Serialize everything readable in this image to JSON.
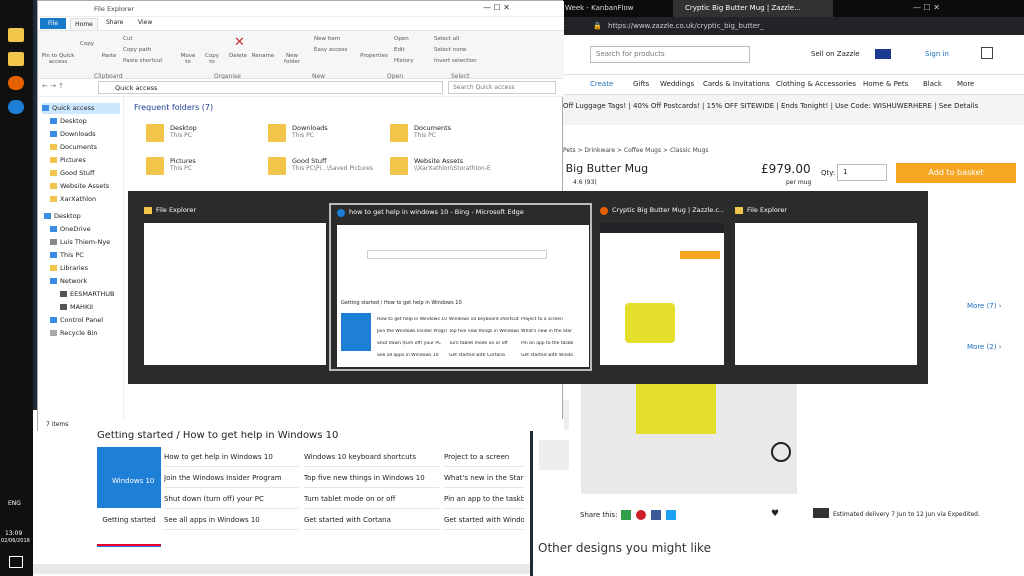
{
  "taskbar": {
    "clock_time": "13:09",
    "clock_date": "02/06/2018",
    "lang": "ENG",
    "items": [
      "explorer",
      "explorer",
      "firefox",
      "edge"
    ]
  },
  "firefox": {
    "tabs": [
      "Week - KanbanFlow",
      "Cryptic Big Butter Mug | Zazzle..."
    ],
    "url": "https://www.zazzle.co.uk/cryptic_big_butter_",
    "search_placeholder": "Search for products",
    "sell": "Sell on Zazzle",
    "signin": "Sign in",
    "nav": [
      "Create",
      "Gifts",
      "Weddings",
      "Cards & Invitations",
      "Clothing & Accessories",
      "Home & Pets",
      "Black",
      "More"
    ],
    "promo": "Off Luggage Tags! | 40% Off Postcards! | 15% OFF SITEWIDE | Ends Tonight! | Use Code: WISHUWERHERE | See Details",
    "crumbs": "Pets > Drinkware > Coffee Mugs > Classic Mugs",
    "product": "ic Big Butter Mug",
    "rating": "4.6 (93)",
    "price": "£979.00",
    "per": "per mug",
    "qty_label": "Qty:",
    "qty_value": "1",
    "add": "Add to basket",
    "more1": "More (7) ›",
    "more2": "More (2) ›",
    "share": "Share this:",
    "delivery": "Estimated delivery 7 Jun to 12 Jun via Expedited.",
    "other": "Other designs you might like"
  },
  "explorer": {
    "title": "File Explorer",
    "menu": [
      "File",
      "Home",
      "Share",
      "View"
    ],
    "clipboard": [
      "Pin to Quick access",
      "Copy",
      "Paste",
      "Cut",
      "Copy path",
      "Paste shortcut"
    ],
    "organise": [
      "Move to",
      "Copy to",
      "Delete",
      "Rename"
    ],
    "new": [
      "New folder",
      "New item",
      "Easy access"
    ],
    "open": [
      "Properties",
      "Open",
      "Edit",
      "History"
    ],
    "select": [
      "Select all",
      "Select none",
      "Invert selection"
    ],
    "groups": [
      "Clipboard",
      "Organise",
      "New",
      "Open",
      "Select"
    ],
    "address": "Quick access",
    "search": "Search Quick access",
    "nav": [
      "Quick access",
      "Desktop",
      "Downloads",
      "Documents",
      "Pictures",
      "Good Stuff",
      "Website Assets",
      "XarXathlon",
      "Desktop",
      "OneDrive",
      "Luis Thiem-Nye",
      "This PC",
      "Libraries",
      "Network",
      "EESMARTHUB",
      "MAHKII",
      "Control Panel",
      "Recycle Bin"
    ],
    "section": "Frequent folders (7)",
    "folders": [
      {
        "name": "Desktop",
        "sub": "This PC"
      },
      {
        "name": "Downloads",
        "sub": "This PC"
      },
      {
        "name": "Documents",
        "sub": "This PC"
      },
      {
        "name": "Pictures",
        "sub": "This PC"
      },
      {
        "name": "Good Stuff",
        "sub": "This PC\\Pi...\\Saved Pictures"
      },
      {
        "name": "Website Assets",
        "sub": "\\\\XarXathlon\\Storathlon-E"
      }
    ],
    "status": "7 items"
  },
  "alttab": {
    "items": [
      "File Explorer",
      "how to get help in windows 10 - Bing - Microsoft Edge",
      "Cryptic Big Butter Mug | Zazzle.c...",
      "File Explorer"
    ]
  },
  "edge": {
    "heading": "Getting started / How to get help in Windows 10",
    "tile": "Windows 10",
    "tile_label": "Getting started",
    "rows": [
      [
        "How to get help in Windows 10",
        "Windows 10 keyboard shortcuts",
        "Project to a screen"
      ],
      [
        "Join the Windows Insider Program",
        "Top five new things in Windows 10",
        "What's new in the Star"
      ],
      [
        "Shut down (turn off) your PC",
        "Turn tablet mode on or off",
        "Pin an app to the taskb"
      ],
      [
        "See all apps in Windows 10",
        "Get started with Cortana",
        "Get started with Windo"
      ]
    ]
  }
}
